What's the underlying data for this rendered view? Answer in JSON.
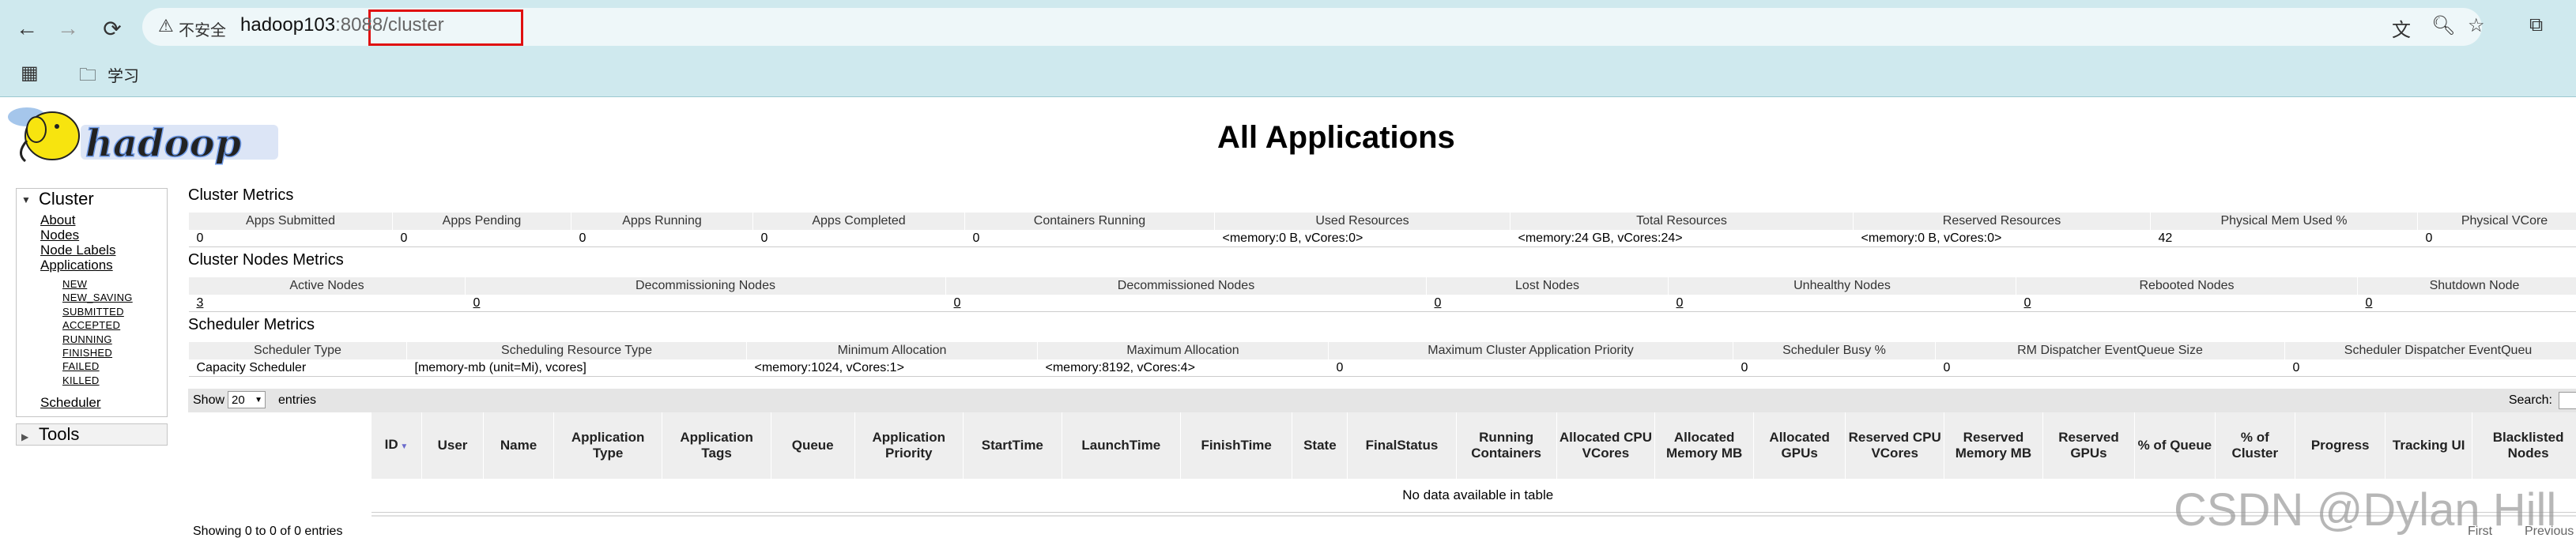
{
  "browser": {
    "url_warning": "不安全",
    "url_host": "hadoop103",
    "url_port": ":8088",
    "url_path": "/cluster",
    "bookmark_folder": "学习"
  },
  "header": {
    "title": "All Applications"
  },
  "sidebar": {
    "cluster_label": "Cluster",
    "links": [
      "About",
      "Nodes",
      "Node Labels",
      "Applications"
    ],
    "app_states": [
      "NEW",
      "NEW_SAVING",
      "SUBMITTED",
      "ACCEPTED",
      "RUNNING",
      "FINISHED",
      "FAILED",
      "KILLED"
    ],
    "scheduler_label": "Scheduler",
    "tools_label": "Tools"
  },
  "cluster_metrics": {
    "title": "Cluster Metrics",
    "headers": [
      "Apps Submitted",
      "Apps Pending",
      "Apps Running",
      "Apps Completed",
      "Containers Running",
      "Used Resources",
      "Total Resources",
      "Reserved Resources",
      "Physical Mem Used %",
      "Physical VCore"
    ],
    "values": [
      "0",
      "0",
      "0",
      "0",
      "0",
      "<memory:0 B, vCores:0>",
      "<memory:24 GB, vCores:24>",
      "<memory:0 B, vCores:0>",
      "42",
      "0"
    ]
  },
  "node_metrics": {
    "title": "Cluster Nodes Metrics",
    "headers": [
      "Active Nodes",
      "Decommissioning Nodes",
      "Decommissioned Nodes",
      "Lost Nodes",
      "Unhealthy Nodes",
      "Rebooted Nodes",
      "Shutdown Node"
    ],
    "values": [
      "3",
      "0",
      "0",
      "0",
      "0",
      "0",
      "0"
    ]
  },
  "scheduler_metrics": {
    "title": "Scheduler Metrics",
    "headers": [
      "Scheduler Type",
      "Scheduling Resource Type",
      "Minimum Allocation",
      "Maximum Allocation",
      "Maximum Cluster Application Priority",
      "Scheduler Busy %",
      "RM Dispatcher EventQueue Size",
      "Scheduler Dispatcher EventQueu"
    ],
    "values": [
      "Capacity Scheduler",
      "[memory-mb (unit=Mi), vcores]",
      "<memory:1024, vCores:1>",
      "<memory:8192, vCores:4>",
      "0",
      "0",
      "0",
      "0"
    ]
  },
  "apps_table": {
    "show_label": "Show",
    "page_size": "20",
    "entries_label": "entries",
    "search_label": "Search:",
    "columns": [
      "ID",
      "User",
      "Name",
      "Application Type",
      "Application Tags",
      "Queue",
      "Application Priority",
      "StartTime",
      "LaunchTime",
      "FinishTime",
      "State",
      "FinalStatus",
      "Running Containers",
      "Allocated CPU VCores",
      "Allocated Memory MB",
      "Allocated GPUs",
      "Reserved CPU VCores",
      "Reserved Memory MB",
      "Reserved GPUs",
      "% of Queue",
      "% of Cluster",
      "Progress",
      "Tracking UI",
      "Blacklisted Nodes"
    ],
    "empty_message": "No data available in table",
    "info": "Showing 0 to 0 of 0 entries",
    "paginate_first": "First",
    "paginate_previous": "Previous"
  },
  "watermark": "CSDN @Dylan Hill"
}
